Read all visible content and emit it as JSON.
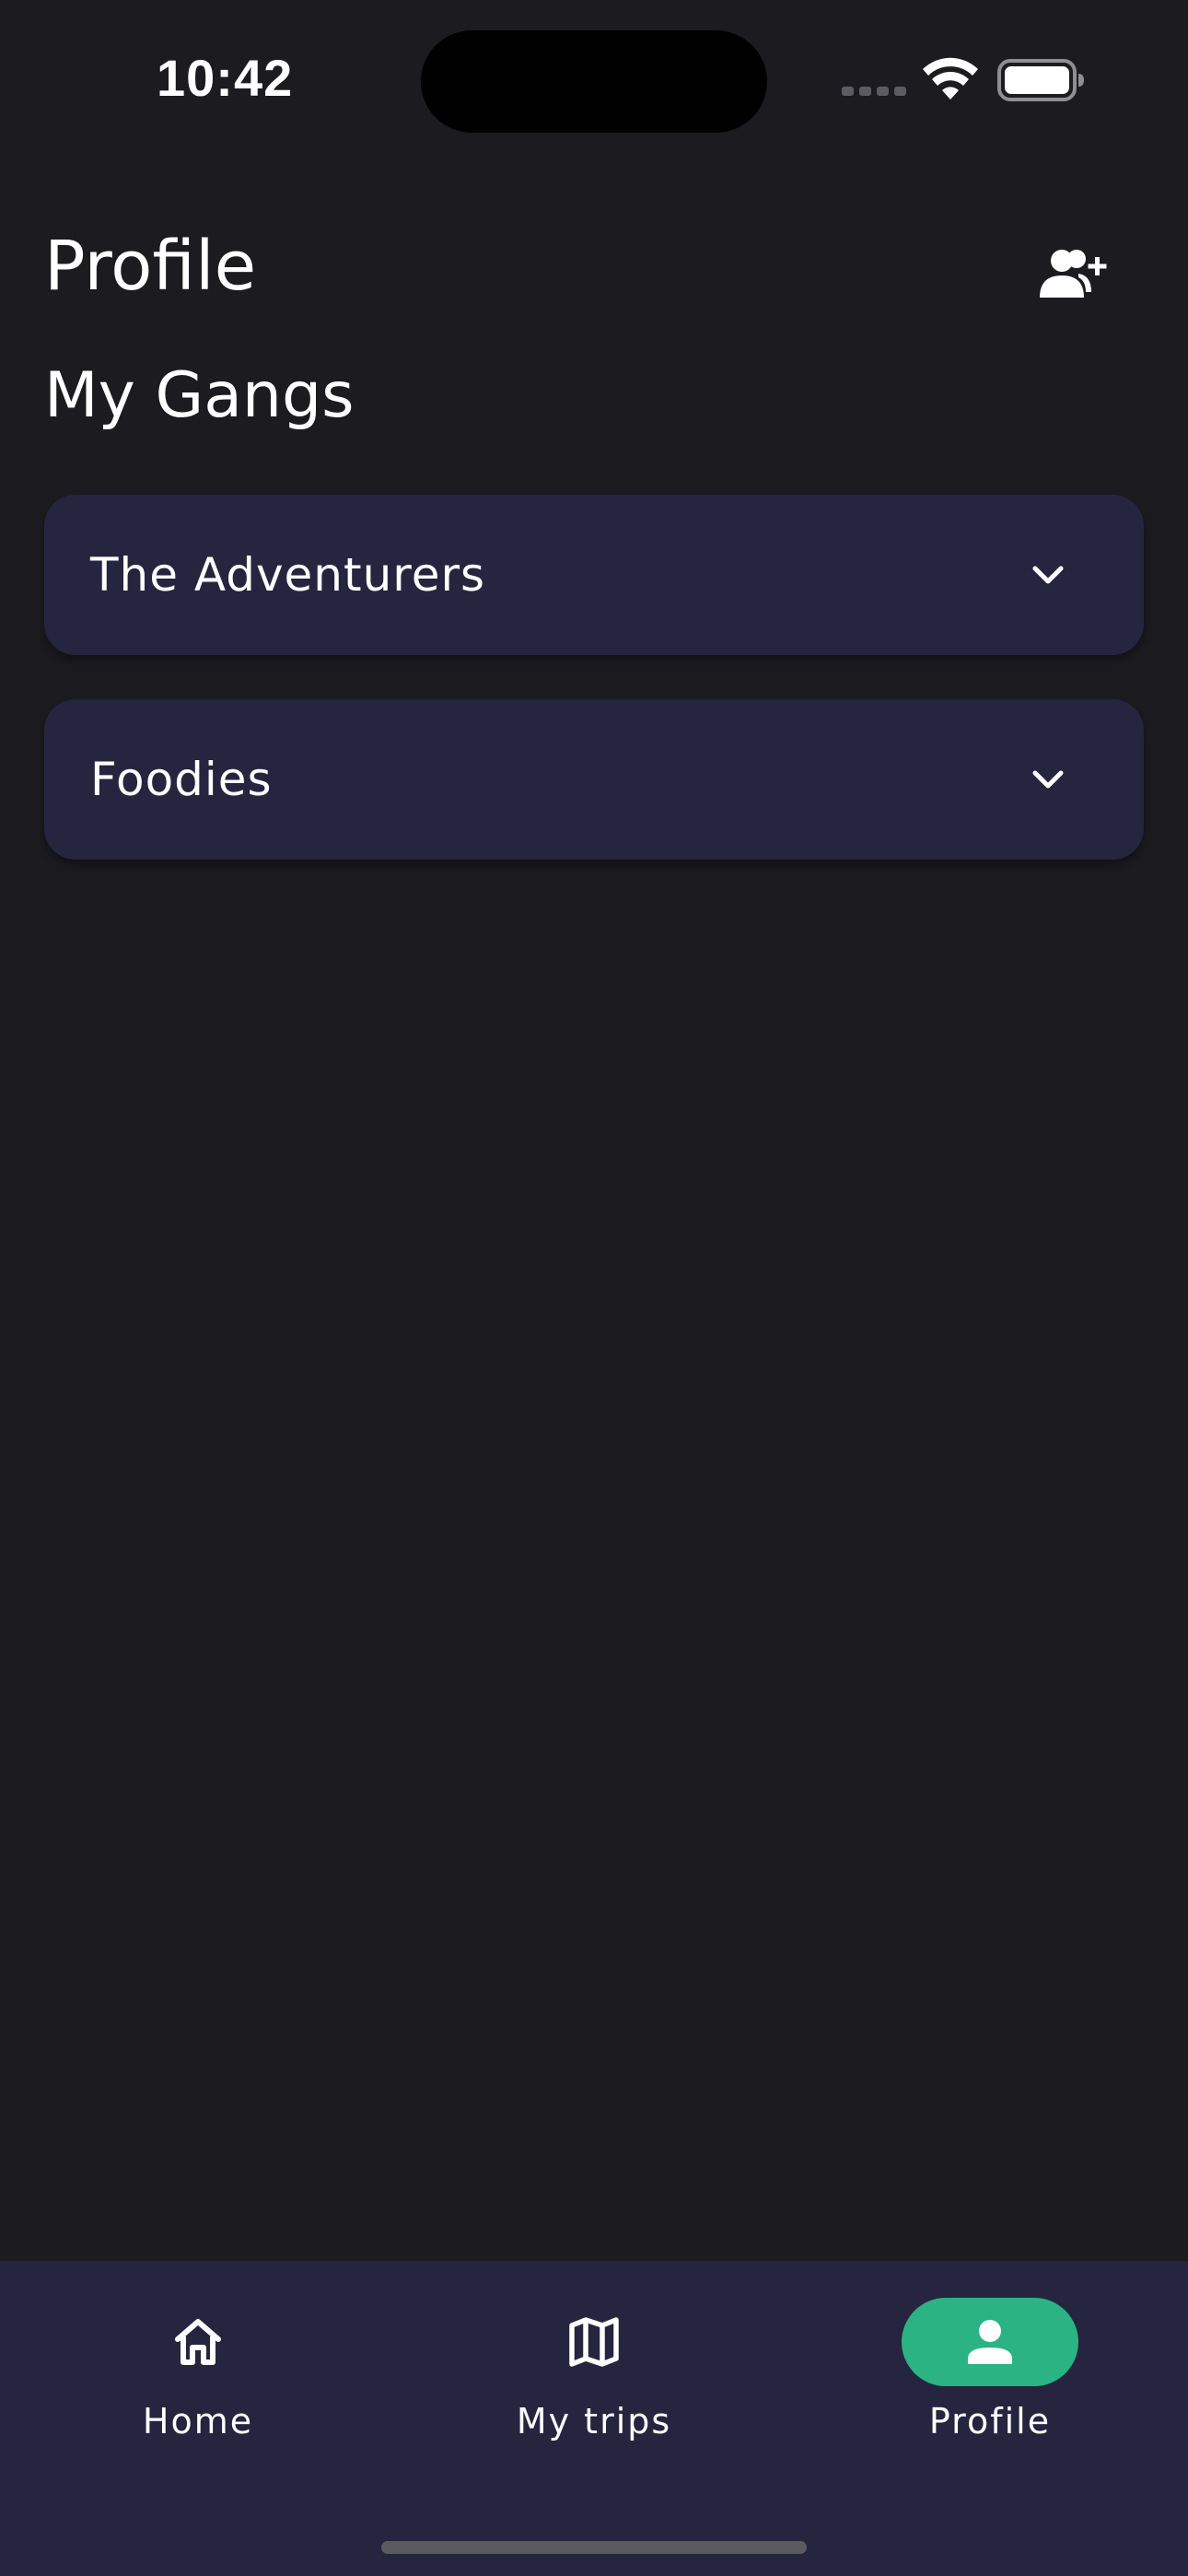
{
  "status_bar": {
    "time": "10:42"
  },
  "header": {
    "title": "Profile",
    "add_user_icon": "add-user-icon"
  },
  "section": {
    "title": "My Gangs"
  },
  "gangs": [
    {
      "name": "The Adventurers",
      "icon": "chevron-down-icon"
    },
    {
      "name": "Foodies",
      "icon": "chevron-down-icon"
    }
  ],
  "bottom_nav": {
    "items": [
      {
        "label": "Home",
        "icon": "home-icon",
        "active": false
      },
      {
        "label": "My trips",
        "icon": "map-icon",
        "active": false
      },
      {
        "label": "Profile",
        "icon": "person-icon",
        "active": true
      }
    ]
  },
  "colors": {
    "background": "#1b1b20",
    "card": "#25253f",
    "nav_background": "#25253f",
    "accent": "#2bb383",
    "text": "#ffffff"
  }
}
